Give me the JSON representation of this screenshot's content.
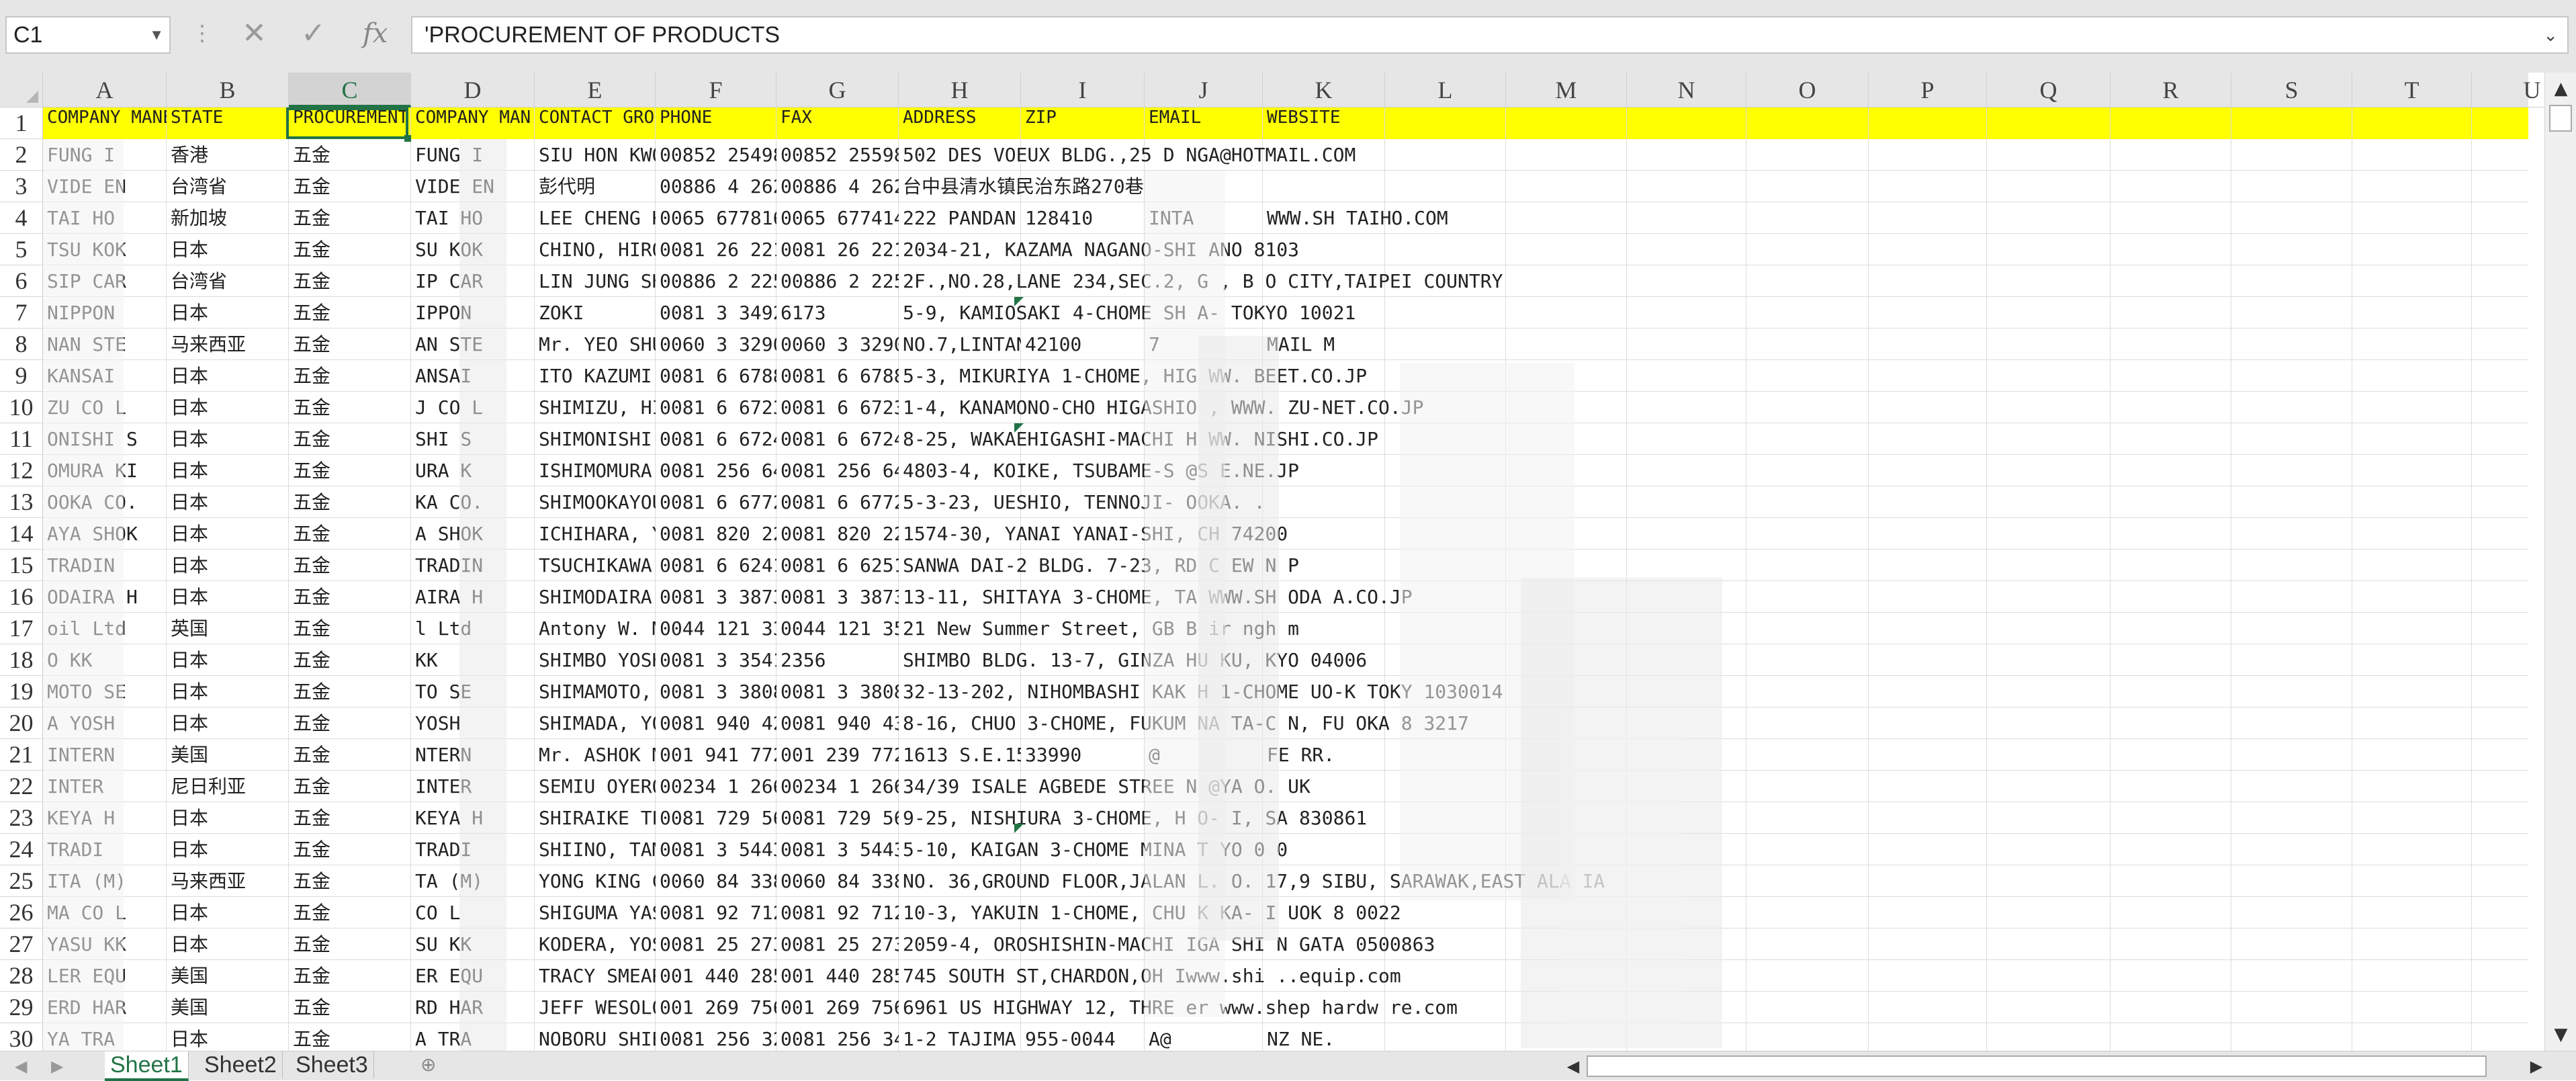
{
  "formula_bar": {
    "name_box": "C1",
    "cancel_icon": "✕",
    "confirm_icon": "✓",
    "fx_label": "fx",
    "formula_value": "'PROCUREMENT OF PRODUCTS"
  },
  "columns": [
    "A",
    "B",
    "C",
    "D",
    "E",
    "F",
    "G",
    "H",
    "I",
    "J",
    "K",
    "L",
    "M",
    "N",
    "O",
    "P",
    "Q",
    "R",
    "S",
    "T",
    "U"
  ],
  "selected_column": "C",
  "rows": [
    "1",
    "2",
    "3",
    "4",
    "5",
    "6",
    "7",
    "8",
    "9",
    "10",
    "11",
    "12",
    "13",
    "14",
    "15",
    "16",
    "17",
    "18",
    "19",
    "20",
    "21",
    "22",
    "23",
    "24",
    "25",
    "26",
    "27",
    "28",
    "29",
    "30"
  ],
  "header_row": {
    "a": "COMPANY MANE",
    "b": "STATE",
    "c": "PROCUREMENT",
    "d": "COMPANY  MAN",
    "e": "CONTACT  GROU",
    "f": "PHONE",
    "g": "FAX",
    "h": "ADDRESS",
    "i": "ZIP",
    "j": "EMAIL",
    "k": "WEBSITE"
  },
  "data_rows": [
    {
      "a": "    FUNG  I",
      "b": "香港",
      "c": "五金",
      "d": "   FUNG  I",
      "e": "SIU HON KWON",
      "f": "00852 25498",
      "g": "00852 255984",
      "h": "502 DES VOEUX BLDG.,25 D           NGA@HOTMAIL.COM"
    },
    {
      "a": "   VIDE EN",
      "b": "台湾省",
      "c": "五金",
      "d": "  VIDE EN",
      "e": "彭代明",
      "f": "00886 4 2626",
      "g": "00886 4 2626",
      "h": "台中县清水镇民治东路270巷"
    },
    {
      "a": "   TAI HO",
      "b": "新加坡",
      "c": "五金",
      "d": "   TAI HO",
      "e": "LEE CHENG KE",
      "f": "0065 677816",
      "g": "0065 677414",
      "h": "222 PANDAN L",
      "i": "128410",
      "j": "        INTA",
      "k": "WWW.SH  TAIHO.COM"
    },
    {
      "a": "   TSU KOK",
      "b": "日本",
      "c": "五金",
      "d": "   SU KOK",
      "e": "CHINO, HIROY",
      "f": "0081 26 221",
      "g": "0081 26 2216",
      "h": "2034-21, KAZAMA NAGANO-SHI      ANO  8103"
    },
    {
      "a": "   SIP CAR",
      "b": "台湾省",
      "c": "五金",
      "d": "   IP CAR",
      "e": "LIN JUNG SHE",
      "f": "00886 2 2255",
      "g": "00886 2 2255",
      "h": "2F.,NO.28,LANE 234,SEC.2,   G    , B   O CITY,TAIPEI COUNTRY"
    },
    {
      "a": "   NIPPON",
      "b": "日本",
      "c": "五金",
      "d": "   IPPON",
      "e": "ZOKI",
      "f": "0081 3 3492",
      "g": "6173",
      "h": "5-9, KAMIOSAKI 4-CHOME SH      A-   TOKYO  10021"
    },
    {
      "a": "   NAN STE",
      "b": "马来西亚",
      "c": "五金",
      "d": "   AN STE",
      "e": "Mr. YEO SHUE",
      "f": "0060 3 32905",
      "g": "0060 3 32906",
      "h": "NO.7,LINTANG",
      "i": "42100",
      "j": "       7",
      "k": "   MAIL   M"
    },
    {
      "a": "   KANSAI",
      "b": "日本",
      "c": "五金",
      "d": "   ANSAI",
      "e": "ITO KAZUMI",
      "f": "0081 6 67881",
      "g": "0081 6 67881",
      "h": "5-3, MIKURIYA 1-CHOME, HIG        WW.  BEET.CO.JP"
    },
    {
      "a": "   ZU CO L",
      "b": "日本",
      "c": "五金",
      "d": "   J CO L",
      "e": "SHIMIZU, HIR",
      "f": "0081 6 6723",
      "g": "0081 6 6723",
      "h": "1-4, KANAMONO-CHO HIGASHIO      ,  WWW.   ZU-NET.CO.JP"
    },
    {
      "a": "   ONISHI S",
      "b": "日本",
      "c": "五金",
      "d": "   SHI S",
      "e": "SHIMONISHI I",
      "f": "0081 6 67249",
      "g": "0081 6 67242",
      "h": "8-25, WAKAEHIGASHI-MACHI      H  WW.   NISHI.CO.JP"
    },
    {
      "a": "   OMURA KI",
      "b": "日本",
      "c": "五金",
      "d": "   URA K",
      "e": "ISHIMOMURA E",
      "f": "0081 256 64",
      "g": "0081 256 64",
      "h": "4803-4, KOIKE, TSUBAME-S        @S   E.NE.JP"
    },
    {
      "a": "   OOKA CO.",
      "b": "日本",
      "c": "五金",
      "d": "   KA CO.",
      "e": "SHIMOOKAYOU",
      "f": "0081 6 67723",
      "g": "0081 6 67723",
      "h": "5-3-23, UESHIO, TENNOJI-       OOKA.  ."
    },
    {
      "a": "   AYA SHOK",
      "b": "日本",
      "c": "五金",
      "d": "   A SHOK",
      "e": "ICHIHARA, YA",
      "f": "0081 820 22",
      "g": "0081 820 22",
      "h": "1574-30, YANAI YANAI-SHI,       CH  74200"
    },
    {
      "a": "   TRADIN",
      "b": "日本",
      "c": "五金",
      "d": "   TRADIN",
      "e": "TSUCHIKAWA, ",
      "f": "0081 6 6241",
      "g": "0081 6 6251",
      "h": "SANWA DAI-2 BLDG. 7-23,         RD   C EW    N   P"
    },
    {
      "a": "   ODAIRA H",
      "b": "日本",
      "c": "五金",
      "d": "   AIRA H",
      "e": "SHIMODAIRA Y",
      "f": "0081 3 3873",
      "g": "0081 3 3873",
      "h": "13-11, SHITAYA 3-CHOME, TA     WWW.SH  ODA  A.CO.JP"
    },
    {
      "a": "   oil Ltd",
      "b": "英国",
      "c": "五金",
      "d": "   l Ltd",
      "e": "Antony W. Mi",
      "f": "0044 121 333",
      "g": "0044 121 3591",
      "h": "21 New Summer Street, GB B    ir  ngh  m"
    },
    {
      "a": "   O KK",
      "b": "日本",
      "c": "五金",
      "d": "   KK",
      "e": "SHIMBO YOSHI",
      "f": "0081 3 3541",
      "g": "2356",
      "h": "SHIMBO BLDG. 13-7, GINZA      HU  KU,  KYO  04006"
    },
    {
      "a": "   MOTO SE",
      "b": "日本",
      "c": "五金",
      "d": "   TO SE",
      "e": "SHIMAMOTO, ",
      "f": "0081 3 3808",
      "g": "0081 3 3808",
      "h": "32-13-202, NIHOMBASHI KAK      H  1-CHOME  UO-K   TOKY  1030014"
    },
    {
      "a": "   A YOSH",
      "b": "日本",
      "c": "五金",
      "d": "   YOSH",
      "e": "SHIMADA, YOS",
      "f": "0081 940 42",
      "g": "0081 940 430",
      "h": "8-16, CHUO 3-CHOME, FUKUM      NA  TA-C N, FU  OKA 8  3217"
    },
    {
      "a": "   INTERN",
      "b": "美国",
      "c": "五金",
      "d": "   NTERN",
      "e": "Mr. ASHOK MA",
      "f": "001 941 7722",
      "g": "001 239 772",
      "h": "1613 S.E.15",
      "i": "33990",
      "j": "        @",
      "k": "FE  RR.   "
    },
    {
      "a": "   INTER",
      "b": "尼日利亚",
      "c": "五金",
      "d": "   INTER",
      "e": "SEMIU OYERO",
      "f": "00234 1 2669",
      "g": "00234 1 2669",
      "h": "34/39 ISALE AGBEDE STREE        N  @YA  O.  UK"
    },
    {
      "a": "   KEYA H",
      "b": "日本",
      "c": "五金",
      "d": "   KEYA H",
      "e": "SHIRAIKE TE",
      "f": "0081 729 56",
      "g": "0081 729 569",
      "h": "9-25, NISHIURA 3-CHOME, H      O-  I,   SA   830861"
    },
    {
      "a": "   TRADI",
      "b": "日本",
      "c": "五金",
      "d": "   TRADI",
      "e": "SHIINO, TAMA",
      "f": "0081 3 5443",
      "g": "0081 3 5443",
      "h": "5-10, KAIGAN 3-CHOME MINA      T  YO   0  0"
    },
    {
      "a": "   ITA (M)",
      "b": "马来西亚",
      "c": "五金",
      "d": "   TA (M)",
      "e": "YONG KING CH",
      "f": "0060 84 3382",
      "g": "0060 84 3382",
      "h": "NO. 36,GROUND FLOOR,JALAN     L. O.    17,9   SIBU, SARAWAK,EAST  ALA  IA"
    },
    {
      "a": "   MA CO L",
      "b": "日本",
      "c": "五金",
      "d": "   CO L",
      "e": "SHIGUMA YASU",
      "f": "0081 92 712",
      "g": "0081 92 712",
      "h": "10-3, YAKUIN 1-CHOME, CHU     K   KA-    I  UOK   8  0022"
    },
    {
      "a": "   YASU KK",
      "b": "日本",
      "c": "五金",
      "d": "   SU KK",
      "e": "KODERA, YOSH",
      "f": "0081 25 273",
      "g": "0081 25 2737",
      "h": "2059-4, OROSHISHIN-MACHI        IGA    SHI  N   GATA  0500863"
    },
    {
      "a": "   LER EQU",
      "b": "美国",
      "c": "五金",
      "d": "   ER EQU",
      "e": "TRACY SMEARM",
      "f": "001 440 2859",
      "g": "001 440 2852",
      "h": "745 SOUTH ST,CHARDON,OH         Iwww.shi  ..equip.com"
    },
    {
      "a": "   ERD HAR",
      "b": "美国",
      "c": "五金",
      "d": "   RD HAR",
      "e": "JEFF WESOLOW",
      "f": "001 269 756",
      "g": "001 269 756",
      "h": "6961 US HIGHWAY 12, THRE         er  www.shep    hardw  re.com"
    },
    {
      "a": "   YA TRA",
      "b": "日本",
      "c": "五金",
      "d": "   A TRA",
      "e": "NOBORU SHIBU",
      "f": "0081 256 321",
      "g": "0081 256 3412",
      "h": "1-2 TAJIMA S",
      "i": "955-0044",
      "j": "       A@",
      "k": "NZ    NE."
    }
  ],
  "sheet_tabs": [
    "Sheet1",
    "Sheet2",
    "Sheet3"
  ],
  "active_sheet": "Sheet1",
  "colors": {
    "header_fill": "#ffff00",
    "accent": "#217346"
  }
}
